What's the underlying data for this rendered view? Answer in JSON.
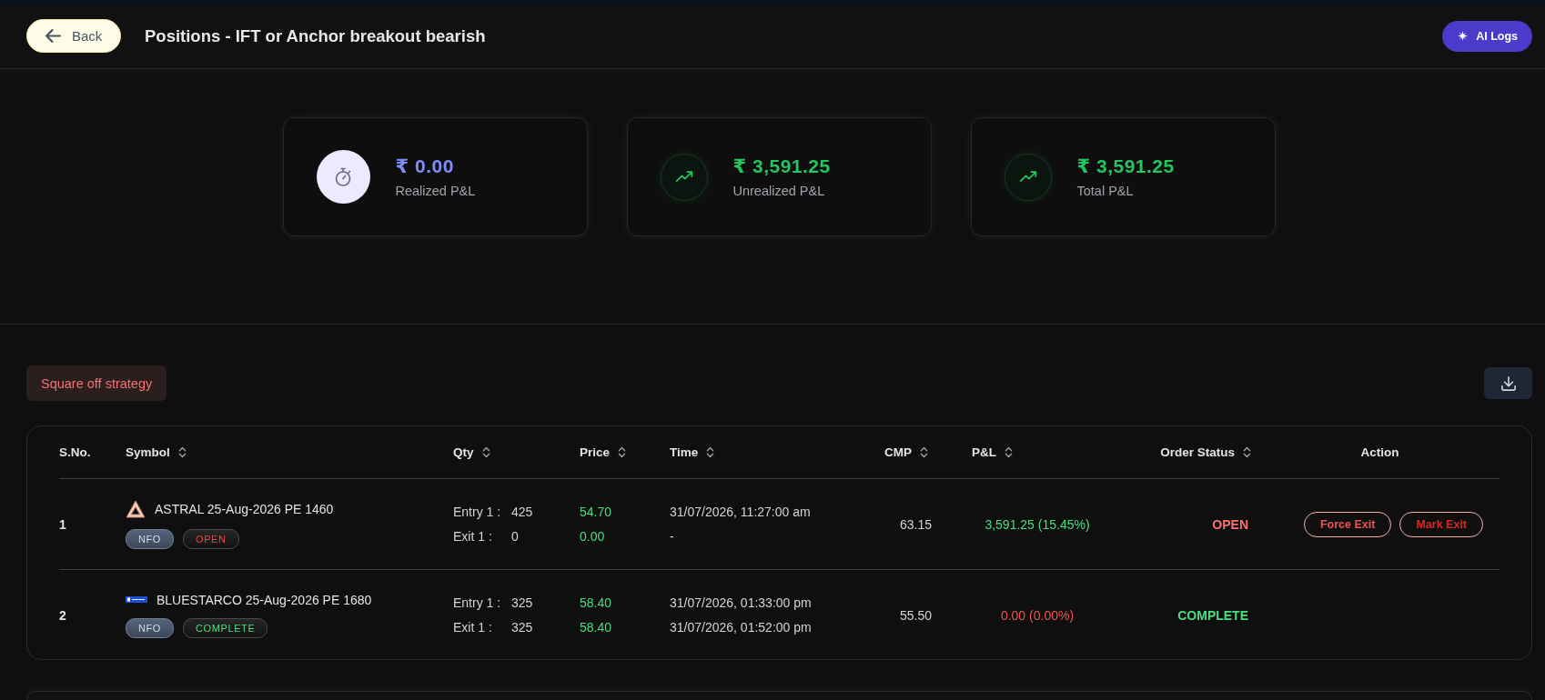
{
  "header": {
    "back_button": "Back",
    "title": "Positions - IFT or Anchor breakout bearish",
    "ai_logs_button": "AI Logs"
  },
  "summary_cards": [
    {
      "kind": "neutral",
      "value": "₹ 0.00",
      "label": "Realized P&L"
    },
    {
      "kind": "trend",
      "value": "₹ 3,591.25",
      "label": "Unrealized P&L"
    },
    {
      "kind": "trend",
      "value": "₹ 3,591.25",
      "label": "Total P&L"
    }
  ],
  "toolbar": {
    "square_off_button": "Square off strategy"
  },
  "table": {
    "columns": [
      {
        "label": "S.No.",
        "sortable": false
      },
      {
        "label": "Symbol",
        "sortable": true
      },
      {
        "label": "Qty",
        "sortable": true
      },
      {
        "label": "Price",
        "sortable": true
      },
      {
        "label": "Time",
        "sortable": true
      },
      {
        "label": "CMP",
        "sortable": true
      },
      {
        "label": "P&L",
        "sortable": true
      },
      {
        "label": "Order Status",
        "sortable": true
      },
      {
        "label": "Action",
        "sortable": false
      }
    ],
    "rows": [
      {
        "sno": "1",
        "logo": {
          "kind": "triangle"
        },
        "symbol": "ASTRAL 25-Aug-2026 PE 1460",
        "tags": [
          {
            "kind": "segment",
            "text": "NFO"
          },
          {
            "kind": "status",
            "text": "OPEN",
            "color": "#ef4444"
          }
        ],
        "legs": [
          {
            "label": "Entry 1 :",
            "qty": "425",
            "price": "54.70",
            "time": "31/07/2026, 11:27:00 am"
          },
          {
            "label": "Exit 1 :",
            "qty": "0",
            "price": "0.00",
            "time": "-"
          }
        ],
        "cmp": "63.15",
        "pnl": {
          "text": "3,591.25 (15.45%)",
          "color": "#4ade80"
        },
        "order_status": {
          "text": "OPEN",
          "color": "#f87171"
        },
        "actions": [
          {
            "label": "Force Exit",
            "color": "#f05252"
          },
          {
            "label": "Mark Exit",
            "color": "#dc2626"
          }
        ]
      },
      {
        "sno": "2",
        "logo": {
          "kind": "banner"
        },
        "symbol": "BLUESTARCO 25-Aug-2026 PE 1680",
        "tags": [
          {
            "kind": "segment",
            "text": "NFO"
          },
          {
            "kind": "status",
            "text": "COMPLETE",
            "color": "#4ade80"
          }
        ],
        "legs": [
          {
            "label": "Entry 1 :",
            "qty": "325",
            "price": "58.40",
            "time": "31/07/2026, 01:33:00 pm"
          },
          {
            "label": "Exit 1 :",
            "qty": "325",
            "price": "58.40",
            "time": "31/07/2026, 01:52:00 pm"
          }
        ],
        "cmp": "55.50",
        "pnl": {
          "text": "0.00 (0.00%)",
          "color": "#ef5350"
        },
        "order_status": {
          "text": "COMPLETE",
          "color": "#4ade80"
        }
      }
    ]
  }
}
